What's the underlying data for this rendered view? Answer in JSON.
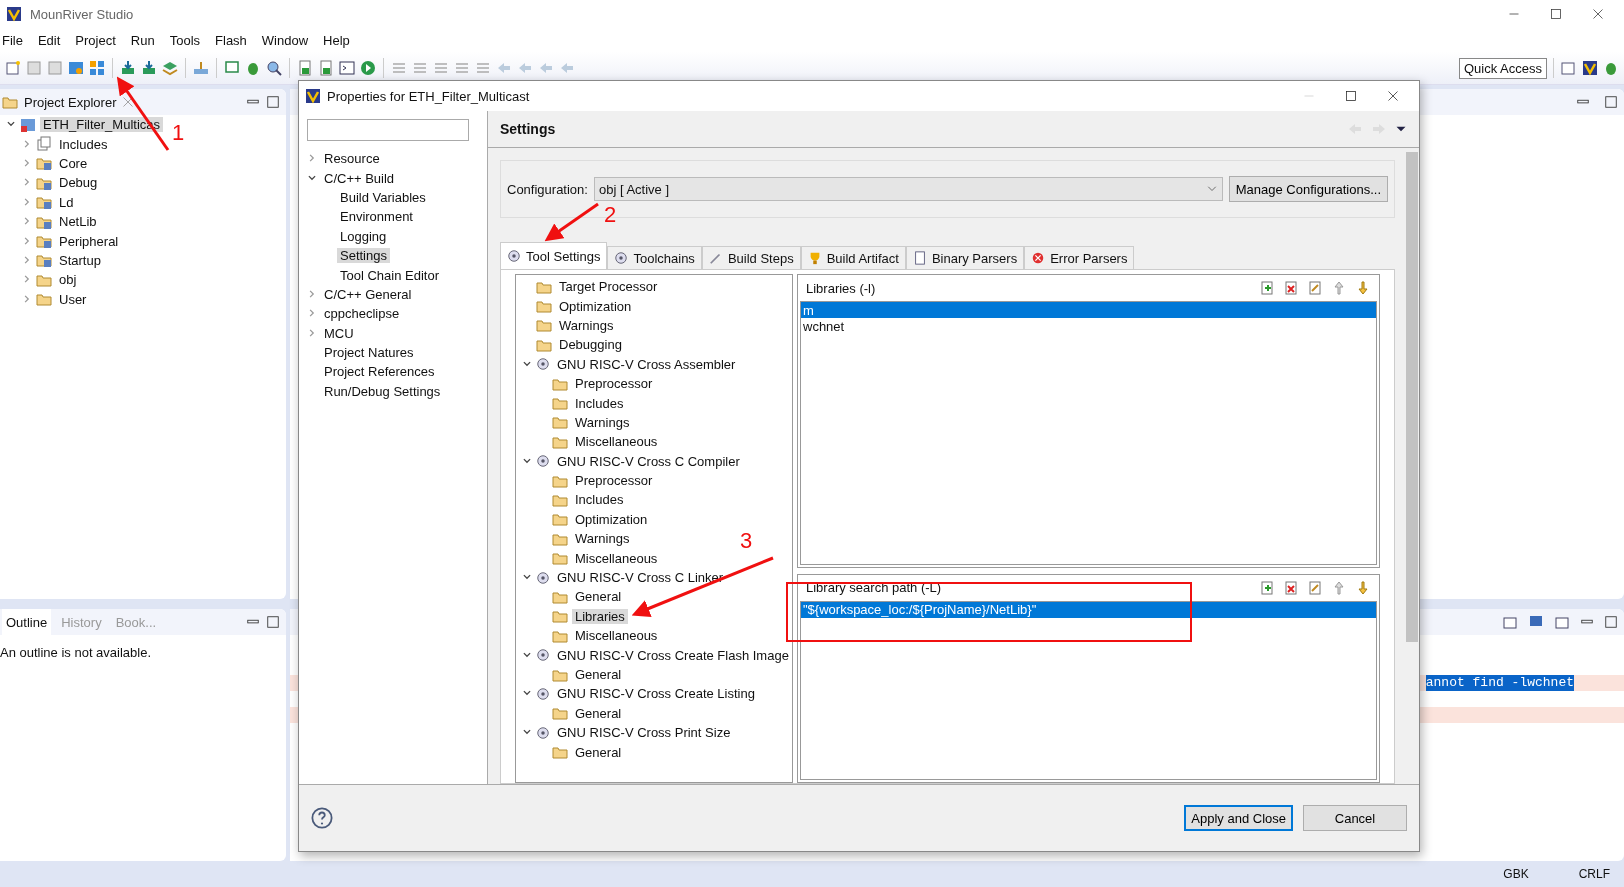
{
  "app": {
    "title": "MounRiver Studio"
  },
  "menu": [
    "File",
    "Edit",
    "Project",
    "Run",
    "Tools",
    "Flash",
    "Window",
    "Help"
  ],
  "quick_access": "Quick Access",
  "project_explorer": {
    "title": "Project Explorer",
    "tree": [
      {
        "label": "ETH_Filter_Multicas",
        "kind": "project",
        "expanded": true,
        "selected": true,
        "children": [
          {
            "label": "Includes",
            "kind": "includes",
            "expanded": false,
            "selected": false
          },
          {
            "label": "Core",
            "kind": "source",
            "expanded": false,
            "selected": false
          },
          {
            "label": "Debug",
            "kind": "source",
            "expanded": false,
            "selected": false
          },
          {
            "label": "Ld",
            "kind": "source",
            "expanded": false,
            "selected": false
          },
          {
            "label": "NetLib",
            "kind": "source",
            "expanded": false,
            "selected": false
          },
          {
            "label": "Peripheral",
            "kind": "source",
            "expanded": false,
            "selected": false
          },
          {
            "label": "Startup",
            "kind": "source",
            "expanded": false,
            "selected": false
          },
          {
            "label": "obj",
            "kind": "folder",
            "expanded": false,
            "selected": false
          },
          {
            "label": "User",
            "kind": "folder",
            "expanded": false,
            "selected": false
          }
        ]
      }
    ]
  },
  "outline": {
    "tabs": [
      {
        "label": "Outline",
        "selected": true
      },
      {
        "label": "History",
        "selected": false
      },
      {
        "label": "Book...",
        "selected": false
      }
    ],
    "message": "An outline is not available."
  },
  "console": {
    "error_text": "annot find -lwchnet"
  },
  "status_bar": {
    "encoding": "GBK",
    "line_ending": "CRLF"
  },
  "dialog": {
    "title": "Properties for ETH_Filter_Multicast",
    "nav": [
      {
        "label": "Resource",
        "expanded": false,
        "selected": false
      },
      {
        "label": "C/C++ Build",
        "expanded": true,
        "selected": false,
        "children": [
          {
            "label": "Build Variables",
            "selected": false
          },
          {
            "label": "Environment",
            "selected": false
          },
          {
            "label": "Logging",
            "selected": false
          },
          {
            "label": "Settings",
            "selected": true
          },
          {
            "label": "Tool Chain Editor",
            "selected": false
          }
        ]
      },
      {
        "label": "C/C++ General",
        "expanded": false,
        "selected": false
      },
      {
        "label": "cppcheclipse",
        "expanded": false,
        "selected": false
      },
      {
        "label": "MCU",
        "expanded": false,
        "selected": false
      },
      {
        "label": "Project Natures",
        "selected": false
      },
      {
        "label": "Project References",
        "selected": false
      },
      {
        "label": "Run/Debug Settings",
        "selected": false
      }
    ],
    "page_title": "Settings",
    "configuration": {
      "label": "Configuration:",
      "value": "obj  [ Active ]",
      "button": "Manage Configurations..."
    },
    "tabs": [
      {
        "label": "Tool Settings",
        "kind": "tool",
        "selected": true
      },
      {
        "label": "Toolchains",
        "kind": "tool",
        "selected": false
      },
      {
        "label": "Build Steps",
        "kind": "steps",
        "selected": false
      },
      {
        "label": "Build Artifact",
        "kind": "artifact",
        "selected": false
      },
      {
        "label": "Binary Parsers",
        "kind": "binary",
        "selected": false
      },
      {
        "label": "Error Parsers",
        "kind": "error",
        "selected": false
      }
    ],
    "tool_tree": [
      {
        "label": "Target Processor",
        "kind": "option",
        "selected": false
      },
      {
        "label": "Optimization",
        "kind": "option",
        "selected": false
      },
      {
        "label": "Warnings",
        "kind": "option",
        "selected": false
      },
      {
        "label": "Debugging",
        "kind": "option",
        "selected": false
      },
      {
        "label": "GNU RISC-V Cross Assembler",
        "kind": "tool",
        "expanded": true,
        "selected": false,
        "children": [
          {
            "label": "Preprocessor",
            "kind": "option",
            "selected": false
          },
          {
            "label": "Includes",
            "kind": "option",
            "selected": false
          },
          {
            "label": "Warnings",
            "kind": "option",
            "selected": false
          },
          {
            "label": "Miscellaneous",
            "kind": "option",
            "selected": false
          }
        ]
      },
      {
        "label": "GNU RISC-V Cross C Compiler",
        "kind": "tool",
        "expanded": true,
        "selected": false,
        "children": [
          {
            "label": "Preprocessor",
            "kind": "option",
            "selected": false
          },
          {
            "label": "Includes",
            "kind": "option",
            "selected": false
          },
          {
            "label": "Optimization",
            "kind": "option",
            "selected": false
          },
          {
            "label": "Warnings",
            "kind": "option",
            "selected": false
          },
          {
            "label": "Miscellaneous",
            "kind": "option",
            "selected": false
          }
        ]
      },
      {
        "label": "GNU RISC-V Cross C Linker",
        "kind": "tool",
        "expanded": true,
        "selected": false,
        "children": [
          {
            "label": "General",
            "kind": "option",
            "selected": false
          },
          {
            "label": "Libraries",
            "kind": "option",
            "selected": true
          },
          {
            "label": "Miscellaneous",
            "kind": "option",
            "selected": false
          }
        ]
      },
      {
        "label": "GNU RISC-V Cross Create Flash Image",
        "kind": "tool",
        "expanded": true,
        "selected": false,
        "children": [
          {
            "label": "General",
            "kind": "option",
            "selected": false
          }
        ]
      },
      {
        "label": "GNU RISC-V Cross Create Listing",
        "kind": "tool",
        "expanded": true,
        "selected": false,
        "children": [
          {
            "label": "General",
            "kind": "option",
            "selected": false
          }
        ]
      },
      {
        "label": "GNU RISC-V Cross Print Size",
        "kind": "tool",
        "expanded": true,
        "selected": false,
        "children": [
          {
            "label": "General",
            "kind": "option",
            "selected": false
          }
        ]
      }
    ],
    "libraries": {
      "title": "Libraries (-l)",
      "items": [
        {
          "label": "m",
          "selected": true
        },
        {
          "label": "wchnet",
          "selected": false
        }
      ]
    },
    "search_paths": {
      "title": "Library search path (-L)",
      "items": [
        {
          "label": "\"${workspace_loc:/${ProjName}/NetLib}\"",
          "selected": true
        }
      ]
    },
    "buttons": [
      {
        "label": "Apply and Close",
        "default": true
      },
      {
        "label": "Cancel",
        "default": false
      }
    ]
  },
  "annotations": [
    {
      "label": "1"
    },
    {
      "label": "2"
    },
    {
      "label": "3"
    }
  ]
}
